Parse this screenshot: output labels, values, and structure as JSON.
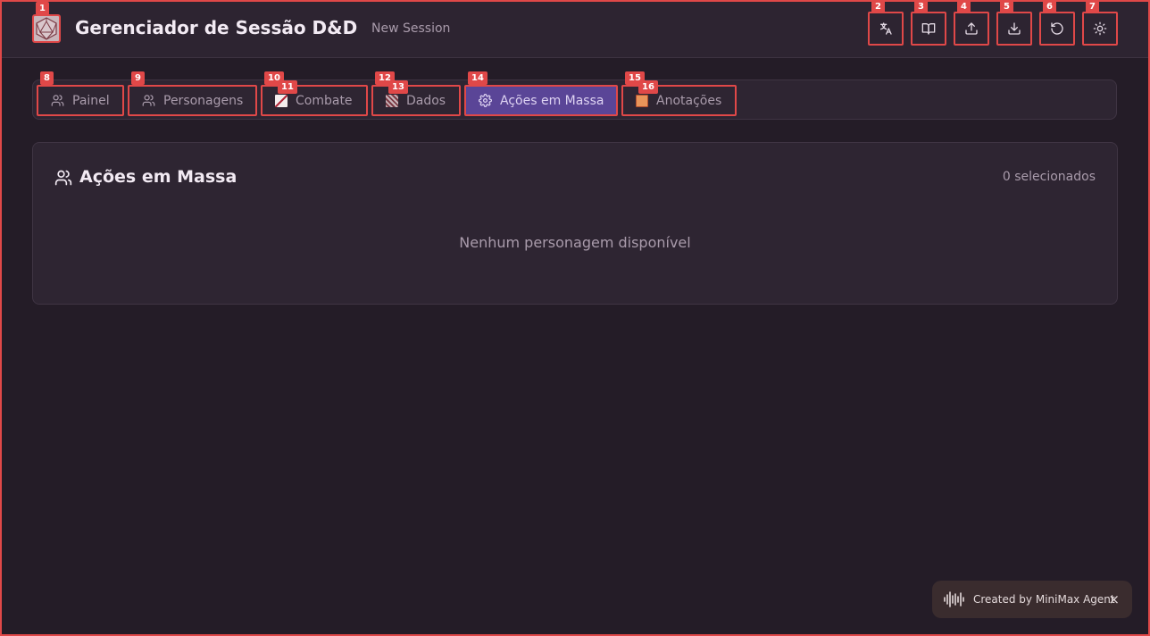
{
  "header": {
    "app_title": "Gerenciador de Sessão D&D",
    "session_name": "New Session",
    "toolbar": [
      {
        "icon": "translate-icon",
        "badge": "2"
      },
      {
        "icon": "book-open-icon",
        "badge": "3"
      },
      {
        "icon": "upload-icon",
        "badge": "4"
      },
      {
        "icon": "download-icon",
        "badge": "5"
      },
      {
        "icon": "reset-icon",
        "badge": "6"
      },
      {
        "icon": "sun-icon",
        "badge": "7"
      }
    ],
    "logo_badge": "1"
  },
  "tabs": [
    {
      "label": "Painel",
      "icon": "users-icon",
      "badge": "8",
      "active": false
    },
    {
      "label": "Personagens",
      "icon": "users-icon",
      "badge": "9",
      "active": false
    },
    {
      "label": "Combate",
      "icon": "combat-image-icon",
      "badge": "10",
      "badge2": "11",
      "active": false
    },
    {
      "label": "Dados",
      "icon": "dice-image-icon",
      "badge": "12",
      "badge2": "13",
      "active": false
    },
    {
      "label": "Ações em Massa",
      "icon": "gear-icon",
      "badge": "14",
      "active": true
    },
    {
      "label": "Anotações",
      "icon": "notes-image-icon",
      "badge": "15",
      "badge2": "16",
      "active": false
    }
  ],
  "main": {
    "title": "Ações em Massa",
    "selected_count": "0 selecionados",
    "empty_message": "Nenhum personagem disponível"
  },
  "toast": {
    "text": "Created by MiniMax Agent",
    "close": "×"
  },
  "colors": {
    "background": "#241c27",
    "header": "#2d2431",
    "panel": "#2e2532",
    "active_tab": "#5a4597",
    "annotation": "#e04848"
  }
}
